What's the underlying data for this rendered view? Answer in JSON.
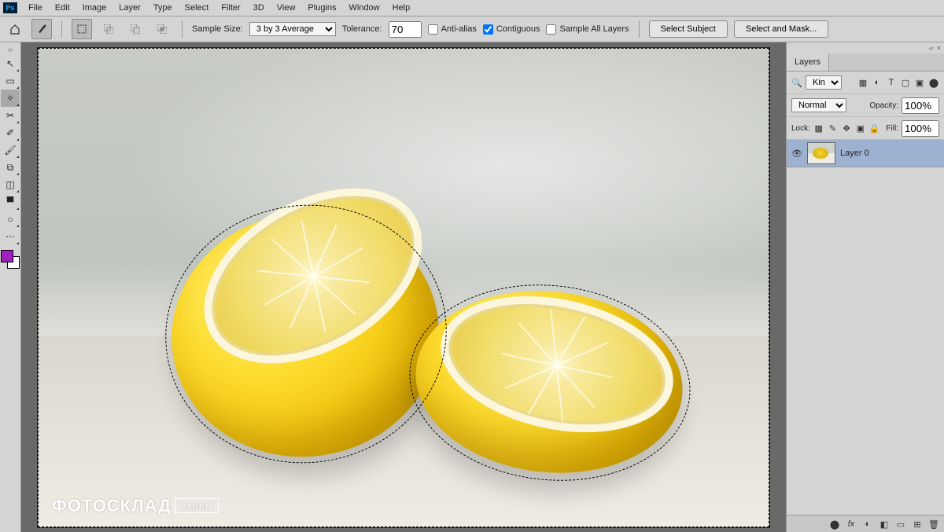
{
  "menubar": [
    "File",
    "Edit",
    "Image",
    "Layer",
    "Type",
    "Select",
    "Filter",
    "3D",
    "View",
    "Plugins",
    "Window",
    "Help"
  ],
  "options": {
    "sampleSizeLabel": "Sample Size:",
    "sampleSizeValue": "3 by 3 Average",
    "toleranceLabel": "Tolerance:",
    "toleranceValue": "70",
    "antiAlias": "Anti-alias",
    "contiguous": "Contiguous",
    "sampleAll": "Sample All Layers",
    "selectSubject": "Select Subject",
    "selectAndMask": "Select and Mask..."
  },
  "tools": [
    {
      "name": "move-tool",
      "icon": "↖"
    },
    {
      "name": "marquee-tool",
      "icon": "▭"
    },
    {
      "name": "magic-wand-tool",
      "icon": "✧",
      "active": true
    },
    {
      "name": "crop-tool",
      "icon": "✂"
    },
    {
      "name": "eyedropper-tool",
      "icon": "✐"
    },
    {
      "name": "brush-tool",
      "icon": "🖌"
    },
    {
      "name": "clone-tool",
      "icon": "⧉"
    },
    {
      "name": "eraser-tool",
      "icon": "◫"
    },
    {
      "name": "gradient-tool",
      "icon": "▀"
    },
    {
      "name": "dodge-tool",
      "icon": "○"
    },
    {
      "name": "more-tools",
      "icon": "⋯"
    }
  ],
  "watermark": {
    "text": "ФОТОСКЛАД",
    "tag": "expert"
  },
  "layersPanel": {
    "tab": "Layers",
    "filterLabel": "Kind",
    "blendMode": "Normal",
    "opacityLabel": "Opacity:",
    "opacityValue": "100%",
    "lockLabel": "Lock:",
    "fillLabel": "Fill:",
    "fillValue": "100%",
    "layerName": "Layer 0"
  },
  "footerIcons": [
    "⊕",
    "fx",
    "◐",
    "◧",
    "▦",
    "⊞",
    "🗑"
  ]
}
